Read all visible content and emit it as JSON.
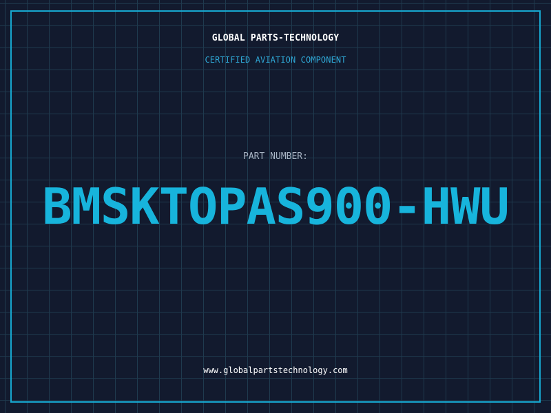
{
  "header": {
    "company_name": "GLOBAL PARTS-TECHNOLOGY",
    "tagline": "CERTIFIED AVIATION COMPONENT"
  },
  "part": {
    "label": "PART NUMBER:",
    "number": "BMSKTOPAS900-HWU"
  },
  "footer": {
    "website": "www.globalpartstechnology.com"
  },
  "colors": {
    "background": "#121a2e",
    "grid": "#1f3a4e",
    "accent": "#17b4dc",
    "text": "#ffffff",
    "muted": "#a8b4c4"
  }
}
